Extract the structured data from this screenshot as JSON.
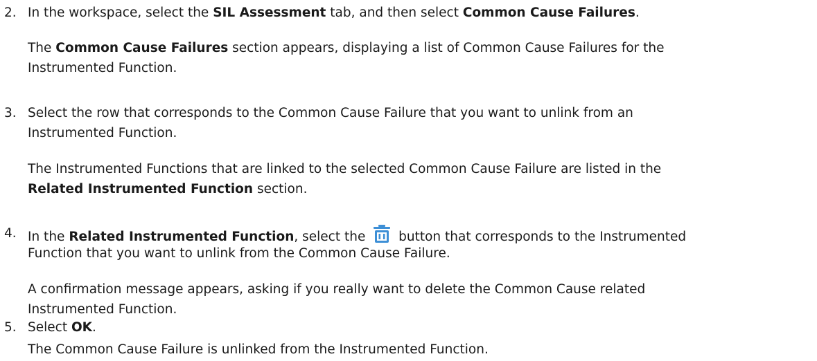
{
  "steps": [
    {
      "number": "2.",
      "instruction": {
        "t1": "In the workspace, select the ",
        "b1": "SIL Assessment",
        "t2": " tab, and then select ",
        "b2": "Common Cause Failures",
        "t3": "."
      },
      "result": {
        "t0": "The ",
        "b1": "Common Cause Failures",
        "t1": " section appears, displaying a list of Common Cause Failures for the",
        "line2": "Instrumented Function."
      }
    },
    {
      "number": "3.",
      "instruction": {
        "line1": "Select the row that corresponds to the Common Cause Failure that you want to unlink from an",
        "line2": "Instrumented Function."
      },
      "result": {
        "line1": "The Instrumented Functions that are linked to the selected Common Cause Failure are listed in the",
        "b1": "Related Instrumented Function",
        "t2": " section."
      }
    },
    {
      "number": "4.",
      "instruction": {
        "t1": "In the ",
        "b1": "Related Instrumented Function",
        "t2": ", select the ",
        "icon": "trash-icon",
        "t3": " button that corresponds to the Instrumented",
        "line2": "Function that you want to unlink from the Common Cause Failure."
      },
      "result": {
        "line1": "A confirmation message appears, asking if you really want to delete the Common Cause related",
        "line2": "Instrumented Function."
      }
    },
    {
      "number": "5.",
      "instruction": {
        "t1": "Select ",
        "b1": "OK",
        "t2": "."
      },
      "result": {
        "line1": "The Common Cause Failure is unlinked from the Instrumented Function."
      }
    }
  ],
  "colors": {
    "text": "#1a1a1a",
    "icon_blue": "#3d8fd6"
  }
}
